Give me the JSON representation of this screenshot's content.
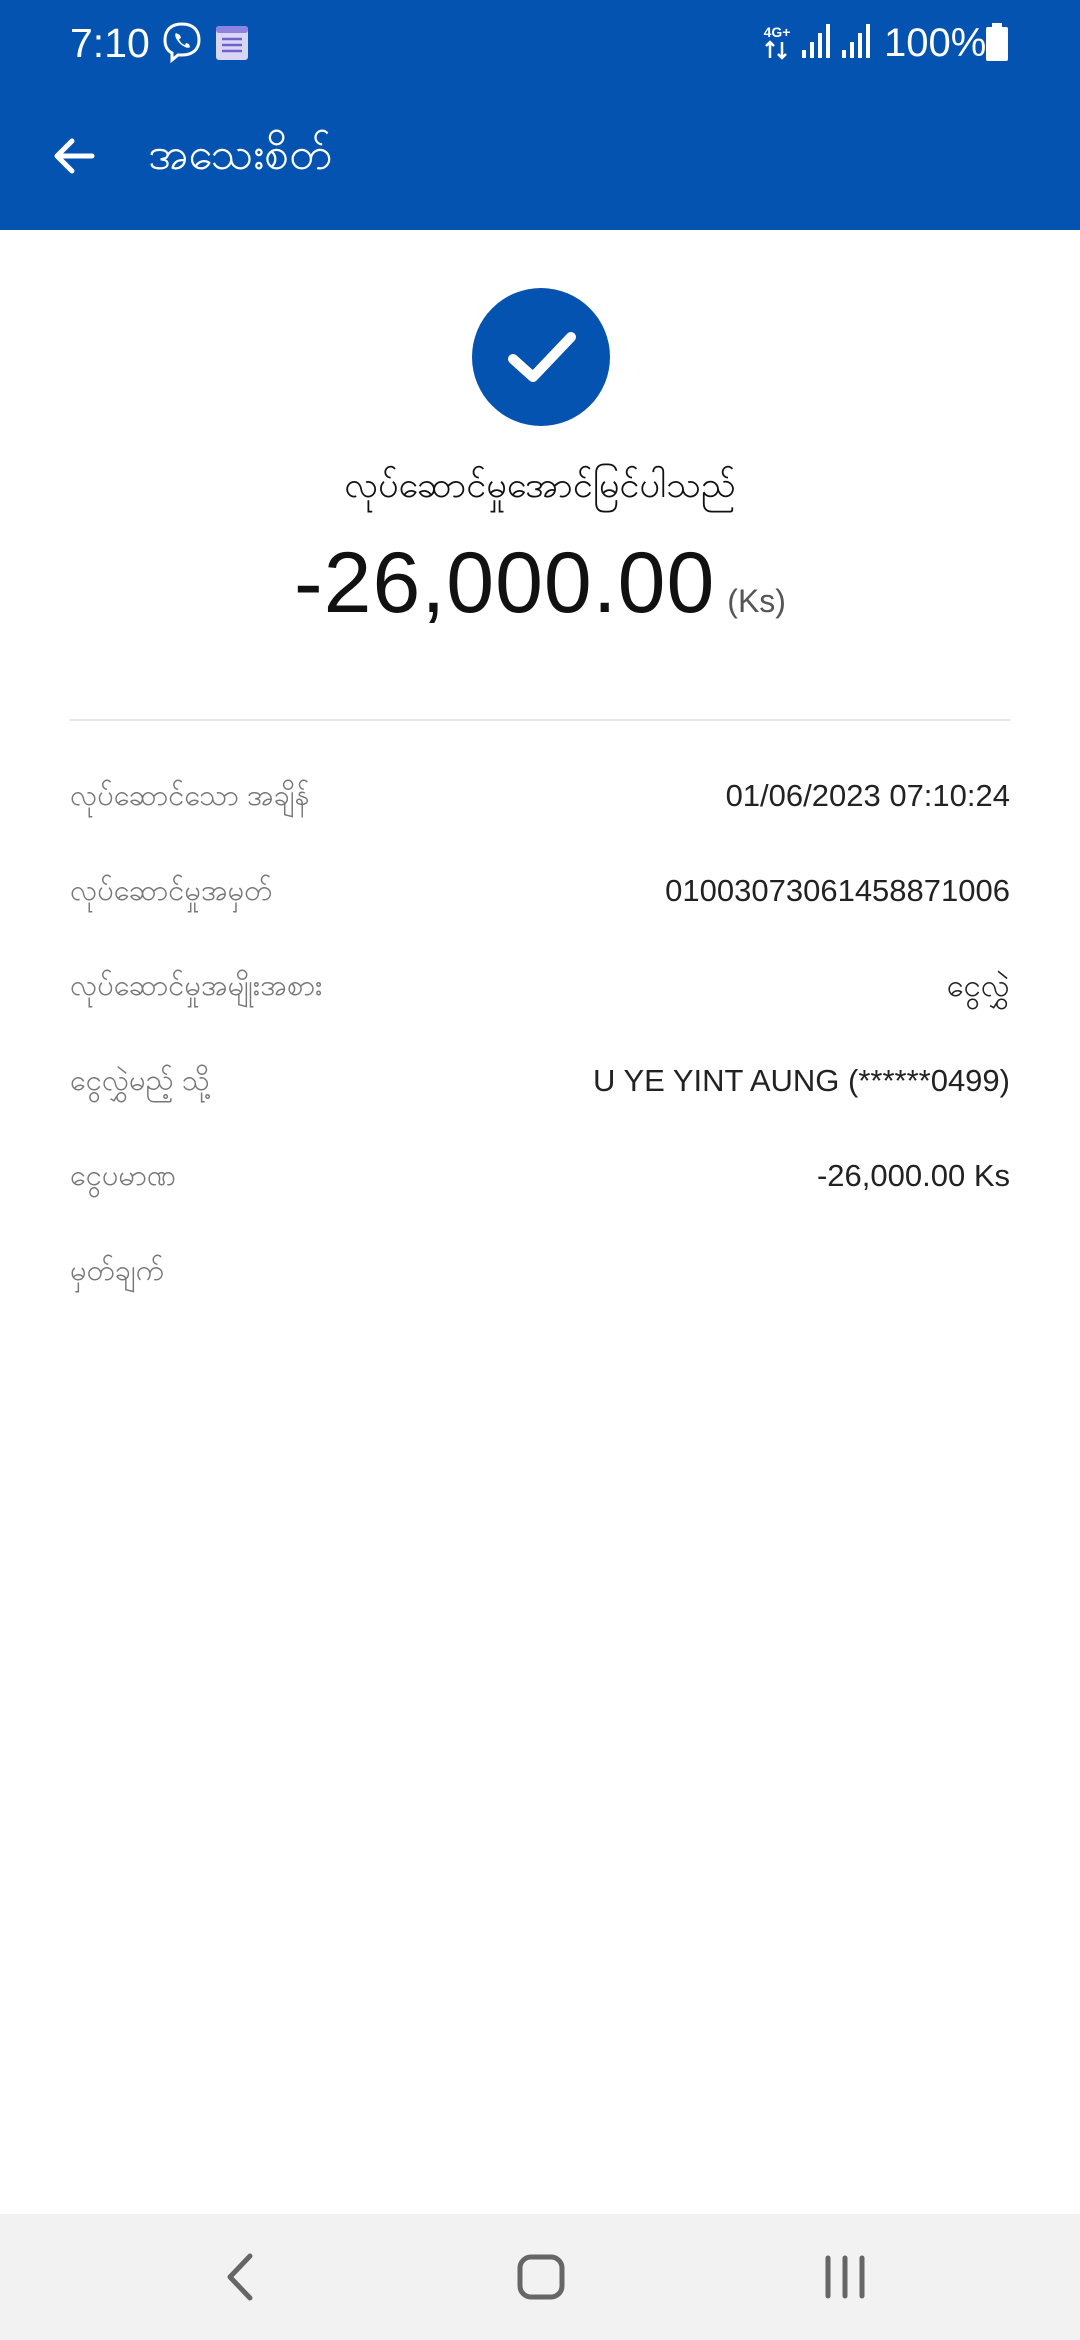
{
  "status_bar": {
    "time": "7:10",
    "network_label": "4G+",
    "battery_percent": "100%",
    "battery_level": 1.0,
    "icons": [
      "viber-icon",
      "notes-icon",
      "network-4g-icon",
      "signal-icon",
      "signal-icon",
      "battery-icon"
    ]
  },
  "header": {
    "title": "အသေးစိတ်",
    "back_icon": "arrow-left-icon",
    "background_color": "#0453b0"
  },
  "result": {
    "icon": "check-icon",
    "message": "လုပ်ဆောင်မှုအောင်မြင်ပါသည်",
    "amount": "-26,000.00",
    "currency": "(Ks)"
  },
  "details": [
    {
      "label": "လုပ်ဆောင်သော အချိန်",
      "value": "01/06/2023 07:10:24"
    },
    {
      "label": "လုပ်ဆောင်မှုအမှတ်",
      "value": "01003073061458871006"
    },
    {
      "label": "လုပ်ဆောင်မှုအမျိုးအစား",
      "value": "ငွေလွှဲ"
    },
    {
      "label": "ငွေလွှဲမည့် သို့",
      "value": "U YE YINT AUNG (******0499)"
    },
    {
      "label": "ငွေပမာဏ",
      "value": "-26,000.00 Ks"
    },
    {
      "label": "မှတ်ချက်",
      "value": ""
    }
  ],
  "nav_bar": {
    "back_icon": "nav-back-icon",
    "home_icon": "nav-home-icon",
    "recents_icon": "nav-recents-icon"
  }
}
